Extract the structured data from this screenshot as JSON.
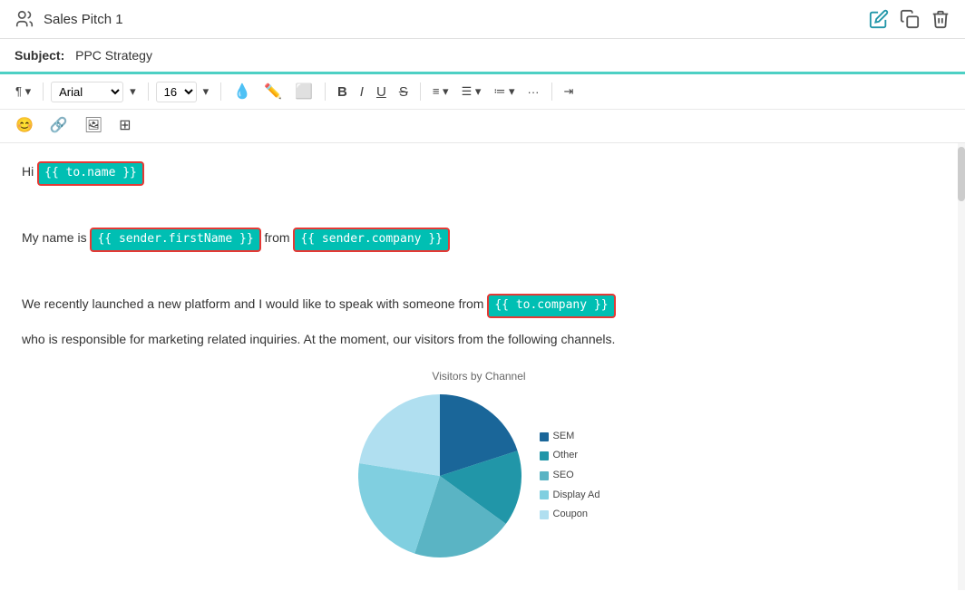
{
  "header": {
    "title": "Sales Pitch 1",
    "icons": [
      "edit-icon",
      "copy-icon",
      "trash-icon"
    ]
  },
  "subject": {
    "label": "Subject:",
    "value": "PPC Strategy"
  },
  "toolbar": {
    "paragraph_label": "¶",
    "font_name": "Arial",
    "font_size": "16",
    "bold_label": "B",
    "italic_label": "I",
    "underline_label": "U",
    "strikethrough_label": "S",
    "align_label": "≡",
    "indent_label": "⇥",
    "emoji_label": "😊",
    "link_label": "🔗",
    "image_label": "🖼",
    "table_label": "⊞"
  },
  "content": {
    "line1_prefix": "Hi ",
    "tag_to_name": "{{ to.name }}",
    "line2_prefix": "My name is ",
    "tag_sender_firstname": "{{ sender.firstName }}",
    "line2_middle": " from ",
    "tag_sender_company": "{{ sender.company }}",
    "line3": "We recently launched a new platform and I would like to speak with someone from ",
    "tag_to_company": "{{ to.company }}",
    "line4": "who is responsible for marketing related inquiries. At the moment, our visitors from the following channels."
  },
  "chart": {
    "title": "Visitors by Channel",
    "legend": [
      {
        "label": "SEM",
        "color": "#1a6699"
      },
      {
        "label": "Other",
        "color": "#2196a8"
      },
      {
        "label": "SEO",
        "color": "#5ab4c4"
      },
      {
        "label": "Display Ad",
        "color": "#80cfe0"
      },
      {
        "label": "Coupon",
        "color": "#b0dff0"
      }
    ]
  }
}
